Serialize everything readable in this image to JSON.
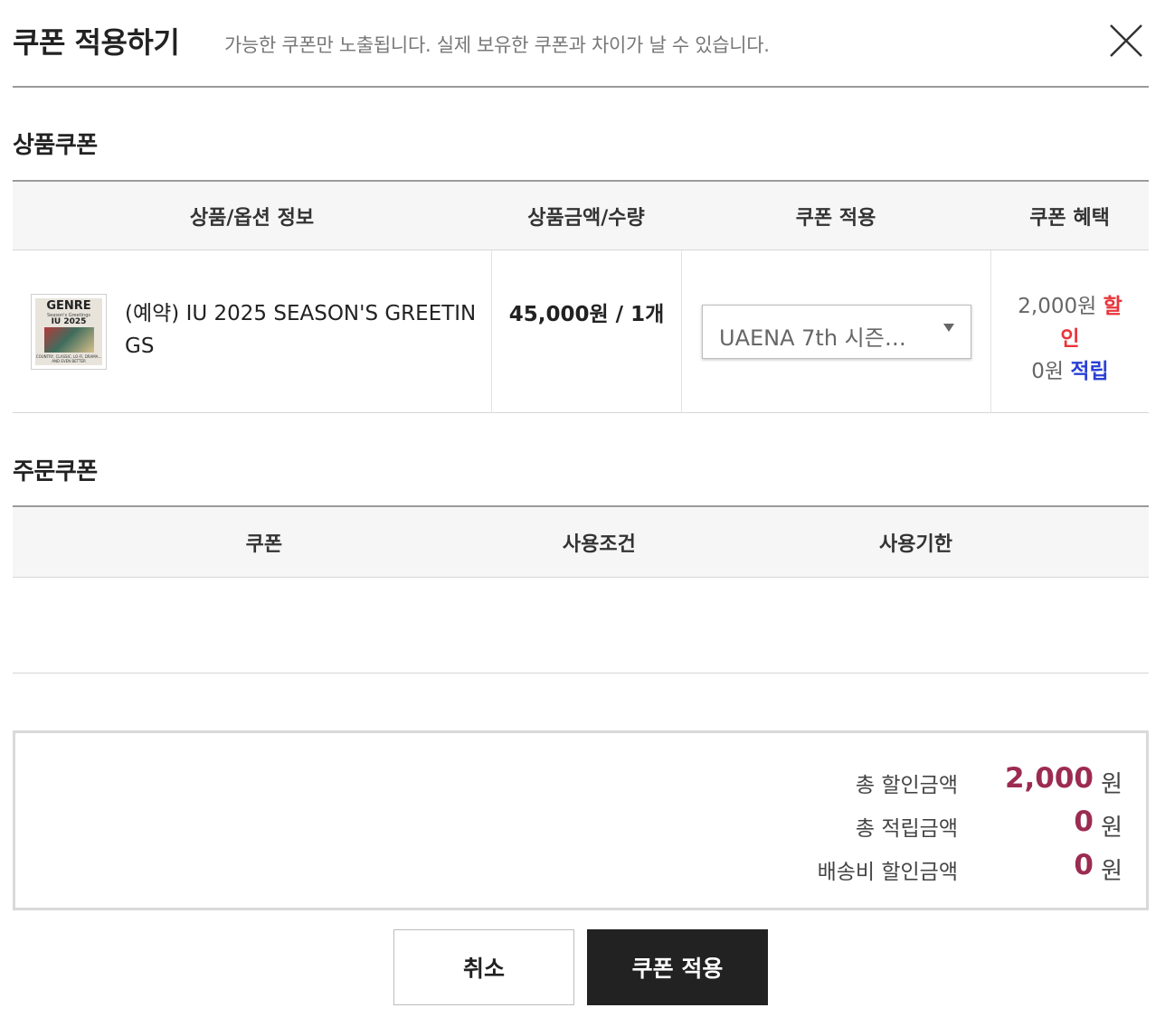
{
  "header": {
    "title": "쿠폰 적용하기",
    "subtitle": "가능한 쿠폰만 노출됩니다. 실제 보유한 쿠폰과 차이가 날 수 있습니다."
  },
  "product_coupon": {
    "section_title": "상품쿠폰",
    "columns": [
      "상품/옵션 정보",
      "상품금액/수량",
      "쿠폰 적용",
      "쿠폰 혜택"
    ],
    "rows": [
      {
        "thumbnail": {
          "title": "GENRE",
          "subtitle": "Season's Greetings",
          "year": "IU 2025",
          "footer": "COUNTRY, CLASSIC, LO-FI, DRAMA... AND EVEN BETTER"
        },
        "name": "(예약) IU 2025 SEASON'S GREETINGS",
        "price_qty": "45,000원 / 1개",
        "coupon_selected": "UAENA 7th 시즌…",
        "benefit": {
          "discount_amount": "2,000원",
          "discount_label": "할인",
          "points_amount": "0원",
          "points_label": "적립"
        }
      }
    ]
  },
  "order_coupon": {
    "section_title": "주문쿠폰",
    "columns": [
      "쿠폰",
      "사용조건",
      "사용기한"
    ]
  },
  "summary": {
    "rows": [
      {
        "label": "총 할인금액",
        "value": "2,000",
        "unit": "원"
      },
      {
        "label": "총 적립금액",
        "value": "0",
        "unit": "원"
      },
      {
        "label": "배송비 할인금액",
        "value": "0",
        "unit": "원"
      }
    ]
  },
  "buttons": {
    "cancel": "취소",
    "apply": "쿠폰 적용"
  },
  "colors": {
    "discount_red": "#e8343a",
    "points_blue": "#2a3fd6",
    "summary_value": "#9c2b52",
    "apply_button_bg": "#222222"
  }
}
